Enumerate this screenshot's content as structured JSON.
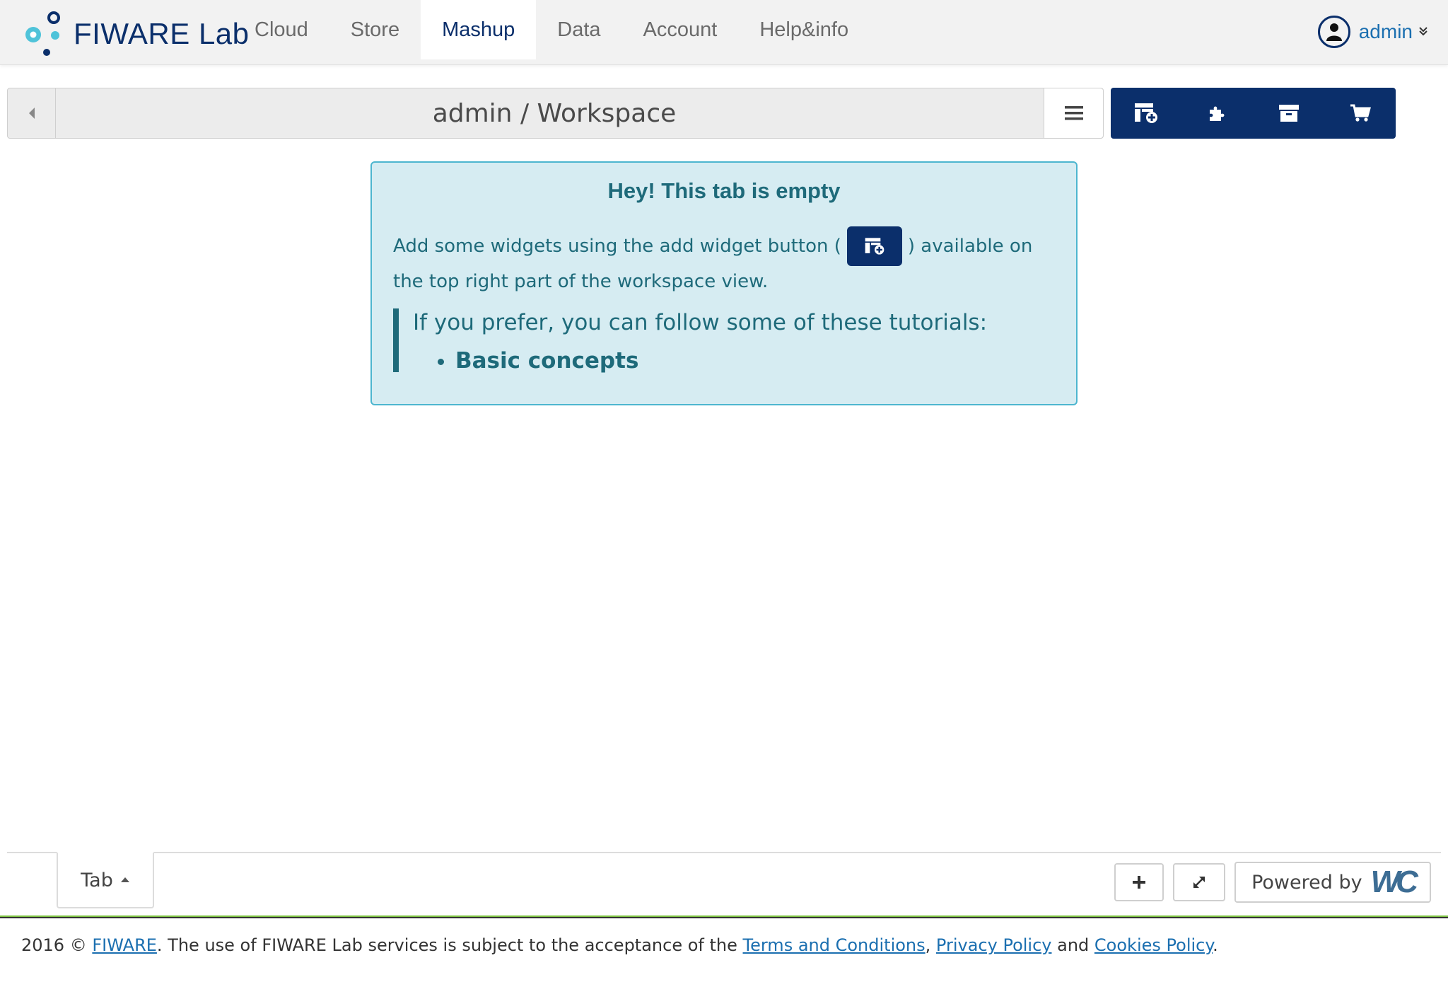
{
  "brand": {
    "name_prefix": "FIWARE",
    "name_suffix": "Lab"
  },
  "nav": {
    "items": [
      {
        "label": "Cloud"
      },
      {
        "label": "Store"
      },
      {
        "label": "Mashup",
        "active": true
      },
      {
        "label": "Data"
      },
      {
        "label": "Account"
      },
      {
        "label": "Help&info"
      }
    ]
  },
  "user": {
    "name": "admin",
    "icon": "user-circle-icon",
    "menu_icon": "double-chevron-down-icon"
  },
  "workspace": {
    "title": "admin / Workspace",
    "back_icon": "caret-left-icon",
    "menu_icon": "hamburger-icon",
    "toolbar": [
      {
        "icon": "add-widget-icon"
      },
      {
        "icon": "puzzle-icon"
      },
      {
        "icon": "archive-icon"
      },
      {
        "icon": "cart-icon"
      }
    ]
  },
  "empty_tab": {
    "title": "Hey! This tab is empty",
    "text_before_button": "Add some widgets using the add widget button (",
    "text_after_button": ") available on",
    "text_line2": "the top right part of the workspace view.",
    "tutorials_intro": "If you prefer, you can follow some of these tutorials:",
    "tutorials": [
      "Basic concepts"
    ]
  },
  "tabbar": {
    "tab_label": "Tab",
    "add_icon": "plus-icon",
    "fullscreen_icon": "expand-icon",
    "powered_by": "Powered by",
    "powered_logo": "WC"
  },
  "footer": {
    "prefix": "2016 ©",
    "fiware_link": "FIWARE",
    "text": ". The use of FIWARE Lab services is subject to the acceptance of the",
    "terms_link": "Terms and Conditions",
    "comma": ",",
    "privacy_link": "Privacy Policy",
    "and": "and",
    "cookies_link": "Cookies Policy",
    "period": "."
  },
  "colors": {
    "primary": "#0b2f6b",
    "alert_bg": "#d6ecf2",
    "alert_text": "#1e6a7a",
    "link": "#1b6fb0"
  }
}
